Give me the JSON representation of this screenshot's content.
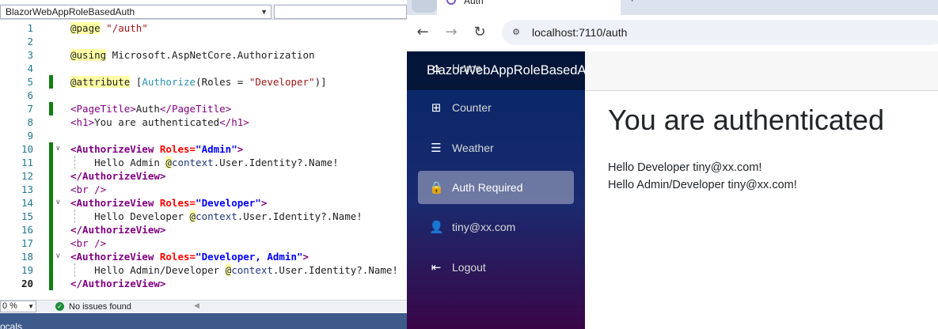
{
  "editor": {
    "project": "BlazorWebAppRoleBasedAuth",
    "zoom": "0 %",
    "status": "No issues found",
    "bottom_panel": "ocals",
    "current_line": 20,
    "lines": [
      {
        "n": "1",
        "mark": false,
        "fold": false,
        "guide": false
      },
      {
        "n": "2",
        "mark": false,
        "fold": false,
        "guide": false
      },
      {
        "n": "3",
        "mark": false,
        "fold": false,
        "guide": false
      },
      {
        "n": "4",
        "mark": false,
        "fold": false,
        "guide": false
      },
      {
        "n": "5",
        "mark": true,
        "fold": false,
        "guide": false
      },
      {
        "n": "6",
        "mark": false,
        "fold": false,
        "guide": false
      },
      {
        "n": "7",
        "mark": true,
        "fold": false,
        "guide": false
      },
      {
        "n": "8",
        "mark": false,
        "fold": false,
        "guide": false
      },
      {
        "n": "9",
        "mark": false,
        "fold": false,
        "guide": false
      },
      {
        "n": "10",
        "mark": true,
        "fold": true,
        "guide": false
      },
      {
        "n": "11",
        "mark": true,
        "fold": false,
        "guide": true
      },
      {
        "n": "12",
        "mark": true,
        "fold": false,
        "guide": false
      },
      {
        "n": "13",
        "mark": true,
        "fold": false,
        "guide": false
      },
      {
        "n": "14",
        "mark": true,
        "fold": true,
        "guide": false
      },
      {
        "n": "15",
        "mark": true,
        "fold": false,
        "guide": true
      },
      {
        "n": "16",
        "mark": true,
        "fold": false,
        "guide": false
      },
      {
        "n": "17",
        "mark": true,
        "fold": false,
        "guide": false
      },
      {
        "n": "18",
        "mark": true,
        "fold": true,
        "guide": false
      },
      {
        "n": "19",
        "mark": true,
        "fold": false,
        "guide": true
      },
      {
        "n": "20",
        "mark": true,
        "fold": false,
        "guide": false
      }
    ],
    "code": {
      "l1": {
        "directive": "@page",
        "value": "\"/auth\""
      },
      "l3": {
        "directive": "@using",
        "value": " Microsoft.AspNetCore.Authorization"
      },
      "l5": {
        "directive": "@attribute",
        "open": " [",
        "type": "Authorize",
        "paren": "(Roles = ",
        "value": "\"Developer\"",
        "close": ")]"
      },
      "l7": {
        "tag_open": "<PageTitle>",
        "text": "Auth",
        "tag_close": "</PageTitle>"
      },
      "l8": {
        "tag_open": "<h1>",
        "text": "You are authenticated",
        "tag_close": "</h1>"
      },
      "l10": {
        "tag": "<AuthorizeView",
        "attr": " Roles=",
        "value": "\"Admin\"",
        "end": ">"
      },
      "l11": {
        "text": "Hello Admin ",
        "at": "@",
        "ctx": "context",
        "rest": ".User.Identity?.Name!"
      },
      "l12": {
        "tag": "</AuthorizeView>"
      },
      "l13": {
        "tag": "<br />"
      },
      "l14": {
        "tag": "<AuthorizeView",
        "attr": " Roles=",
        "value": "\"Developer\"",
        "end": ">"
      },
      "l15": {
        "text": "Hello Developer ",
        "at": "@",
        "ctx": "context",
        "rest": ".User.Identity?.Name!"
      },
      "l16": {
        "tag": "</AuthorizeView>"
      },
      "l17": {
        "tag": "<br />"
      },
      "l18": {
        "tag": "<AuthorizeView",
        "attr": " Roles=",
        "value": "\"Developer, Admin\"",
        "end": ">"
      },
      "l19": {
        "text": "Hello Admin/Developer ",
        "at": "@",
        "ctx": "context",
        "rest": ".User.Identity?.Name!"
      },
      "l20": {
        "tag": "</AuthorizeView>"
      }
    }
  },
  "browser": {
    "tab_title": "Auth",
    "tab_plus": "+",
    "url": "localhost:7110/auth",
    "brand": "BlazorWebAppRoleBasedAuth",
    "nav": [
      {
        "label": "Home",
        "icon": "home-icon",
        "glyph": "⌂",
        "active": false
      },
      {
        "label": "Counter",
        "icon": "plus-square-icon",
        "glyph": "⊞",
        "active": false
      },
      {
        "label": "Weather",
        "icon": "list-icon",
        "glyph": "☰",
        "active": false
      },
      {
        "label": "Auth Required",
        "icon": "lock-icon",
        "glyph": "🔒",
        "active": true
      },
      {
        "label": "tiny@xx.com",
        "icon": "person-icon",
        "glyph": "👤",
        "active": false
      },
      {
        "label": "Logout",
        "icon": "logout-icon",
        "glyph": "⇤",
        "active": false
      }
    ],
    "heading": "You are authenticated",
    "greetings": [
      "Hello Developer tiny@xx.com!",
      "Hello Admin/Developer tiny@xx.com!"
    ]
  }
}
